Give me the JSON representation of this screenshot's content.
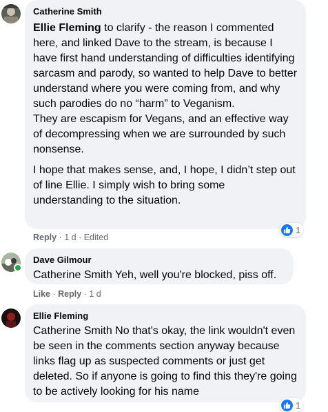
{
  "comments": [
    {
      "author": "Catherine Smith",
      "mention": "Ellie Fleming",
      "para1_rest": "to clarify - the reason I commented here, and linked Dave to the stream, is because I have first hand understanding of difficulties identifying sarcasm and parody, so wanted to help Dave to better understand where you were coming from, and why such parodies do no “harm” to Veganism.",
      "para1_line2": "They are escapism for Vegans, and an effective way of decompressing when we are surrounded by such nonsense.",
      "para2": "I hope that makes sense, and, I hope, I didn’t step out of line Ellie. I simply wish to bring some understanding to the situation.",
      "reply_label": "Reply",
      "time": "1 d",
      "edited": "Edited",
      "reaction_count": "1"
    },
    {
      "author": "Dave Gilmour",
      "text": "Catherine Smith Yeh, well you're blocked, piss off.",
      "like_label": "Like",
      "reply_label": "Reply",
      "time": "1 d"
    },
    {
      "author": "Ellie Fleming",
      "text": "Catherine Smith No that's okay, the link wouldn't even be seen in the comments section anyway because links flag up as suspected comments or just get deleted. So if anyone is going to find this they're going to be actively looking for his name",
      "reaction_count": "1"
    }
  ],
  "separator": "·",
  "colors": {
    "bubble": "#f0f2f5",
    "meta": "#65676b",
    "like": "#1877f2",
    "online": "#31a24c"
  },
  "icons": {
    "reaction": "thumbs-up-icon"
  }
}
